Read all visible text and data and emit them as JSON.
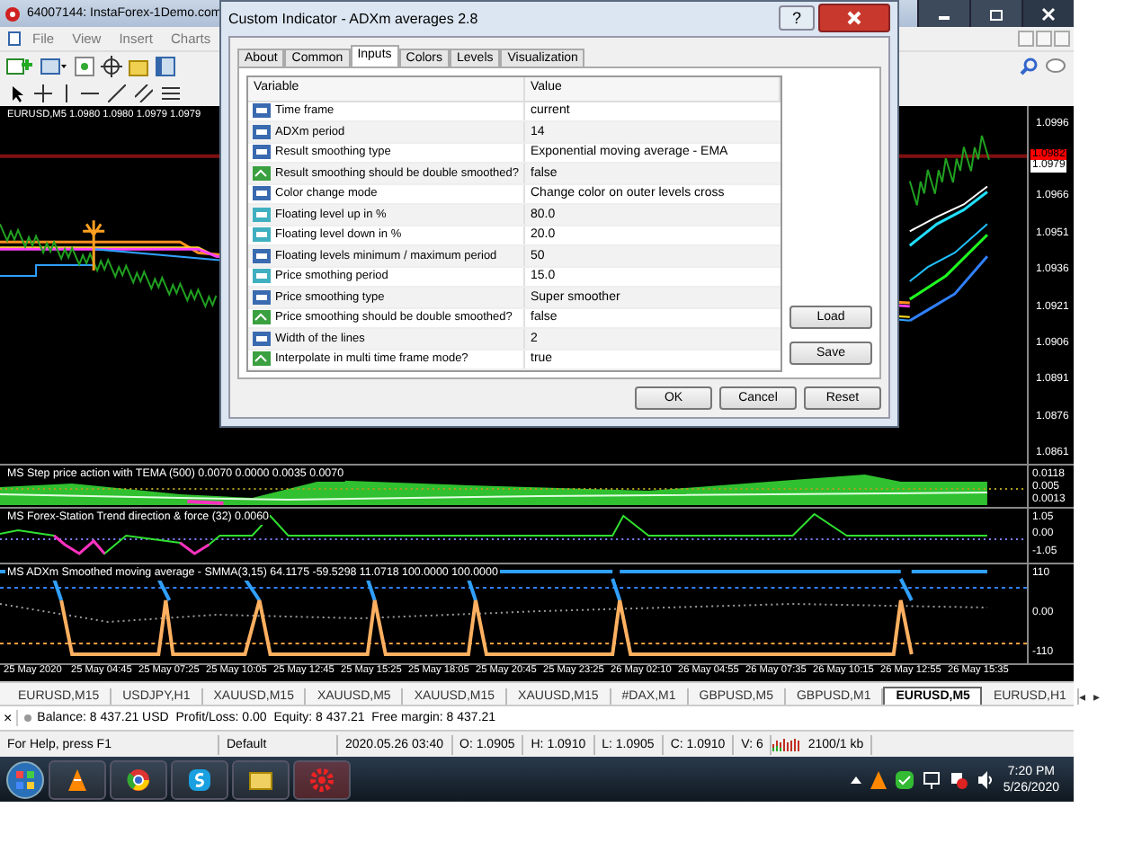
{
  "window": {
    "title": "64007144: InstaForex-1Demo.com"
  },
  "menu": [
    "File",
    "View",
    "Insert",
    "Charts"
  ],
  "main_chart": {
    "label": "EURUSD,M5  1.0980 1.0980 1.0979 1.0979",
    "price_scale": [
      "1.0996",
      "1.0966",
      "1.0951",
      "1.0936",
      "1.0921",
      "1.0906",
      "1.0891",
      "1.0876",
      "1.0861"
    ],
    "price_markers": [
      {
        "text": "1.0982",
        "color": "#ff0000"
      },
      {
        "text": "1.0979",
        "color": "#ffffff"
      }
    ]
  },
  "subwindows": [
    {
      "kind": "area",
      "label": "MS Step price action with TEMA (500) 0.0070 0.0000 0.0035 0.0070",
      "scale": [
        "0.0118",
        "0.005",
        "0.0013"
      ]
    },
    {
      "kind": "trend",
      "label": "MS Forex-Station Trend direction & force (32) 0.0060",
      "scale": [
        "1.05",
        "0.00",
        "-1.05"
      ]
    },
    {
      "kind": "wave",
      "label": "MS ADXm Smoothed moving average - SMMA(3,15) 64.1175 -59.5298 11.0718 100.0000 100.0000",
      "scale": [
        "110",
        "0.00",
        "-110"
      ]
    }
  ],
  "time_axis": [
    "25 May 2020",
    "25 May 04:45",
    "25 May 07:25",
    "25 May 10:05",
    "25 May 12:45",
    "25 May 15:25",
    "25 May 18:05",
    "25 May 20:45",
    "25 May 23:25",
    "26 May 02:10",
    "26 May 04:55",
    "26 May 07:35",
    "26 May 10:15",
    "26 May 12:55",
    "26 May 15:35"
  ],
  "chart_tabs": [
    {
      "label": "EURUSD,M15",
      "selected": false
    },
    {
      "label": "USDJPY,H1",
      "selected": false
    },
    {
      "label": "XAUUSD,M15",
      "selected": false
    },
    {
      "label": "XAUUSD,M5",
      "selected": false
    },
    {
      "label": "XAUUSD,M15",
      "selected": false
    },
    {
      "label": "XAUUSD,M15",
      "selected": false
    },
    {
      "label": "#DAX,M1",
      "selected": false
    },
    {
      "label": "GBPUSD,M5",
      "selected": false
    },
    {
      "label": "GBPUSD,M1",
      "selected": false
    },
    {
      "label": "EURUSD,M5",
      "selected": true
    },
    {
      "label": "EURUSD,H1",
      "selected": false
    }
  ],
  "tab_scroll": [
    "◂",
    "▸"
  ],
  "terminal": {
    "close": "×",
    "text": "Balance: 8 437.21 USD  Profit/Loss: 0.00  Equity: 8 437.21  Free margin: 8 437.21"
  },
  "status_bar": [
    "For Help, press F1",
    "Default",
    "2020.05.26 03:40",
    "O: 1.0905",
    "H: 1.0910",
    "L: 1.0905",
    "C: 1.0910",
    "V: 6",
    "2100/1 kb"
  ],
  "taskbar": {
    "time": "7:20 PM",
    "date": "5/26/2020"
  },
  "dialog": {
    "title": "Custom Indicator - ADXm averages 2.8",
    "help_button": "?",
    "tabs": [
      {
        "label": "About",
        "selected": false
      },
      {
        "label": "Common",
        "selected": false
      },
      {
        "label": "Inputs",
        "selected": true
      },
      {
        "label": "Colors",
        "selected": false
      },
      {
        "label": "Levels",
        "selected": false
      },
      {
        "label": "Visualization",
        "selected": false
      }
    ],
    "columns": [
      "Variable",
      "Value"
    ],
    "rows": [
      {
        "kind": "int",
        "variable": "Time frame",
        "value": "current"
      },
      {
        "kind": "int",
        "variable": "ADXm period",
        "value": "14"
      },
      {
        "kind": "int",
        "variable": "Result smoothing type",
        "value": "Exponential moving average - EMA"
      },
      {
        "kind": "bool",
        "variable": "Result smoothing should be double smoothed?",
        "value": "false"
      },
      {
        "kind": "int",
        "variable": "Color change mode",
        "value": "Change color on outer levels cross"
      },
      {
        "kind": "double",
        "variable": "Floating level up in %",
        "value": "80.0"
      },
      {
        "kind": "double",
        "variable": "Floating level down in %",
        "value": "20.0"
      },
      {
        "kind": "int",
        "variable": "Floating levels minimum / maximum period",
        "value": "50"
      },
      {
        "kind": "double",
        "variable": "Price smothing period",
        "value": "15.0"
      },
      {
        "kind": "int",
        "variable": "Price smoothing type",
        "value": "Super smoother"
      },
      {
        "kind": "bool",
        "variable": "Price smoothing should be double smoothed?",
        "value": "false"
      },
      {
        "kind": "int",
        "variable": "Width of the lines",
        "value": "2"
      },
      {
        "kind": "bool",
        "variable": "Interpolate in multi time frame mode?",
        "value": "true"
      }
    ],
    "side_buttons": [
      "Load",
      "Save"
    ],
    "buttons": [
      "OK",
      "Cancel",
      "Reset"
    ]
  }
}
